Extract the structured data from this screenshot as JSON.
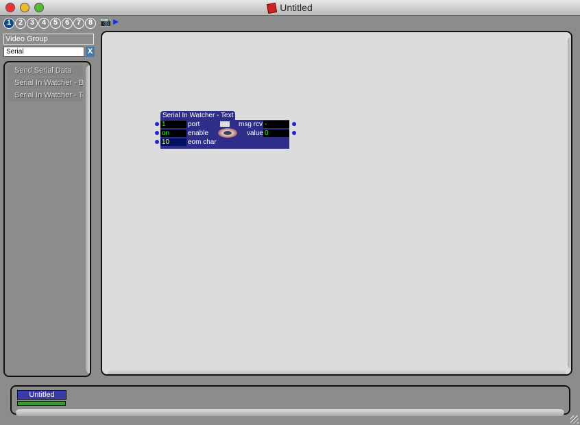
{
  "window": {
    "title": "Untitled"
  },
  "tabs": [
    "1",
    "2",
    "3",
    "4",
    "5",
    "6",
    "7",
    "8"
  ],
  "active_tab": "1",
  "sidebar": {
    "group": "Video Group",
    "search_value": "Serial",
    "clear_label": "X",
    "items": [
      {
        "label": "Send Serial Data"
      },
      {
        "label": "Serial In Watcher - Binary"
      },
      {
        "label": "Serial In Watcher - Text"
      }
    ]
  },
  "actor": {
    "title": "Serial In Watcher - Text",
    "inputs": [
      {
        "value": "1",
        "label": "port"
      },
      {
        "value": "on",
        "label": "enable"
      },
      {
        "value": "10",
        "label": "eom char"
      }
    ],
    "outputs": [
      {
        "label": "msg rcv",
        "value": "-"
      },
      {
        "label": "value",
        "value": "0"
      }
    ]
  },
  "projects": {
    "item": "Untitled",
    "progress": 1.0
  },
  "colors": {
    "actor": "#2e2e88",
    "field_text": "#33ff33",
    "active_tab": "#134a80"
  }
}
